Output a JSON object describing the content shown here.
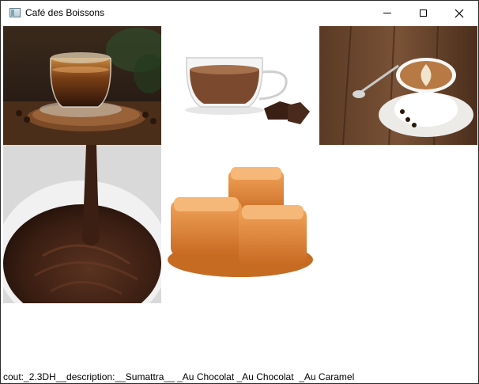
{
  "window": {
    "title": "Café des Boissons",
    "icons": {
      "app": "app-window-icon",
      "minimize": "minimize-icon",
      "maximize": "maximize-icon",
      "close": "close-icon"
    }
  },
  "gallery": {
    "images": [
      {
        "subject": "espresso-glass-cup"
      },
      {
        "subject": "hot-chocolate-glass-cup"
      },
      {
        "subject": "latte-art-cup"
      },
      {
        "subject": "melted-chocolate-bowl"
      },
      {
        "subject": "caramel-cubes"
      }
    ]
  },
  "status_text": "cout:_2.3DH__description:__Sumattra__ _Au Chocolat _Au Chocolat  _Au Caramel"
}
